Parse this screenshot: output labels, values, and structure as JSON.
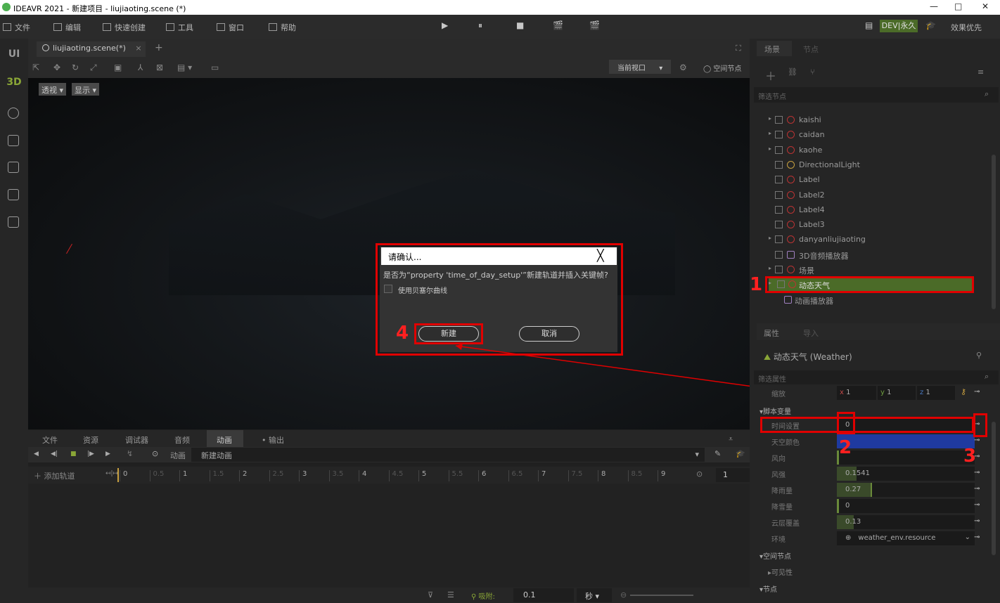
{
  "window": {
    "title": "IDEAVR 2021 - 新建项目 - liujiaoting.scene (*)",
    "min": "—",
    "max": "□",
    "close": "✕"
  },
  "menu": {
    "items": [
      "文件",
      "编辑",
      "快速创建",
      "工具",
      "窗口",
      "帮助"
    ],
    "play": "▶",
    "pause": "⏸",
    "stop": "■",
    "dev": "DEV|永久",
    "quality": "效果优先"
  },
  "leftbar": {
    "ui": "UI",
    "d3": "3D"
  },
  "editor": {
    "tab": "liujiaoting.scene(*)",
    "tab_close": "×",
    "tab_add": "+",
    "current_view": "当前视口",
    "space_node": "空间节点",
    "perspective": "透视",
    "display": "显示"
  },
  "dialog": {
    "title": "请确认...",
    "close": "╳",
    "message": "是否为“property 'time_of_day_setup'”新建轨道并插入关键帧?",
    "checkbox": "使用贝塞尔曲线",
    "ok": "新建",
    "cancel": "取消"
  },
  "annotations": {
    "n1": "1",
    "n2": "2",
    "n3": "3",
    "n4": "4"
  },
  "bottom": {
    "tabs": [
      "文件",
      "资源",
      "调试器",
      "音频",
      "动画",
      "• 输出"
    ],
    "anim_label": "动画",
    "anim_name": "新建动画",
    "add_track": "添加轨道",
    "ticks": [
      "0",
      "0.5",
      "1",
      "1.5",
      "2",
      "2.5",
      "3",
      "3.5",
      "4",
      "4.5",
      "5",
      "5.5",
      "6",
      "6.5",
      "7",
      "7.5",
      "8",
      "8.5",
      "9"
    ],
    "end": "1",
    "snap_label": "吸附:",
    "snap_value": "0.1",
    "unit": "秒"
  },
  "scene_panel": {
    "tabs": [
      "场景",
      "节点"
    ],
    "filter": "筛选节点",
    "nodes": [
      "kaishi",
      "caidan",
      "kaohe",
      "DirectionalLight",
      "Label",
      "Label2",
      "Label4",
      "Label3",
      "danyanliujiaoting",
      "3D音频播放器",
      "场景",
      "动态天气",
      "动画播放器"
    ]
  },
  "inspector": {
    "tabs": [
      "属性",
      "导入"
    ],
    "node": "动态天气 (Weather)",
    "filter": "筛选属性",
    "scale_label": "缩放",
    "sx": "1",
    "sy": "1",
    "sz": "1",
    "x": "x",
    "y": "y",
    "z": "z",
    "script_section": "脚本变量",
    "props": [
      {
        "label": "时间设置",
        "value": "0"
      },
      {
        "label": "天空颜色",
        "value": ""
      },
      {
        "label": "风向",
        "value": ""
      },
      {
        "label": "风强",
        "value": "0.1541"
      },
      {
        "label": "降雨量",
        "value": "0.27"
      },
      {
        "label": "降雪量",
        "value": "0"
      },
      {
        "label": "云层覆盖",
        "value": "0.13"
      },
      {
        "label": "环境",
        "value": "weather_env.resource"
      }
    ],
    "space_section": "空间节点",
    "visible": "可见性",
    "node_section": "节点"
  }
}
